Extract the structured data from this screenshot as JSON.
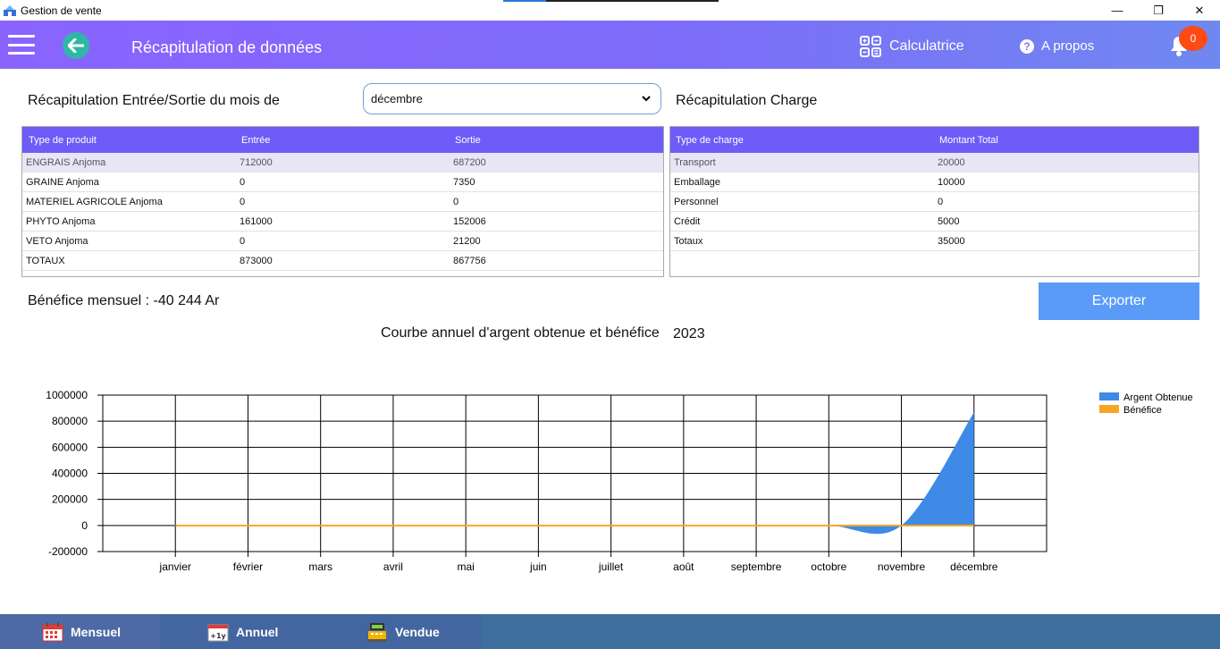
{
  "window": {
    "title": "Gestion de vente",
    "minimize": "—",
    "maximize": "❐",
    "close": "✕"
  },
  "header": {
    "page_title": "Récapitulation de données",
    "calculator_label": "Calculatrice",
    "about_label": "A propos",
    "about_icon": "?",
    "notification_count": "0"
  },
  "entry_section": {
    "title": "Récapitulation Entrée/Sortie  du mois de",
    "selected_month": "décembre",
    "columns": [
      "Type de produit",
      "Entrée",
      "Sortie"
    ],
    "rows": [
      [
        "ENGRAIS Anjoma",
        "712000",
        "687200"
      ],
      [
        "GRAINE Anjoma",
        "0",
        "7350"
      ],
      [
        "MATERIEL AGRICOLE Anjoma",
        "0",
        "0"
      ],
      [
        "PHYTO Anjoma",
        "161000",
        "152006"
      ],
      [
        "VETO Anjoma",
        "0",
        "21200"
      ],
      [
        "TOTAUX",
        "873000",
        "867756"
      ]
    ]
  },
  "charge_section": {
    "title": "Récapitulation Charge",
    "columns": [
      "Type de charge",
      "Montant Total"
    ],
    "rows": [
      [
        "Transport",
        "20000"
      ],
      [
        "Emballage",
        "10000"
      ],
      [
        "Personnel",
        "0"
      ],
      [
        "Crédit",
        "5000"
      ],
      [
        "Totaux",
        "35000"
      ]
    ]
  },
  "benefit": {
    "label": "Bénéfice mensuel :",
    "value": "-40 244 Ar"
  },
  "export_label": "Exporter",
  "chart_heading": {
    "title": "Courbe annuel d'argent obtenue et bénéfice",
    "year": "2023"
  },
  "chart_data": {
    "type": "area",
    "title": "",
    "categories": [
      "janvier",
      "février",
      "mars",
      "avril",
      "mai",
      "juin",
      "juillet",
      "août",
      "septembre",
      "octobre",
      "novembre",
      "décembre"
    ],
    "ylim": [
      -200000,
      1000000
    ],
    "yticks": [
      1000000,
      800000,
      600000,
      400000,
      200000,
      0,
      -200000
    ],
    "grid": true,
    "legend": "top-right",
    "series": [
      {
        "name": "Argent Obtenue",
        "color": "#3e8ae6",
        "values": [
          0,
          0,
          0,
          0,
          0,
          0,
          0,
          0,
          0,
          0,
          0,
          867756
        ]
      },
      {
        "name": "Bénéfice",
        "color": "#f5a623",
        "values": [
          0,
          0,
          0,
          0,
          0,
          0,
          0,
          0,
          0,
          0,
          0,
          0
        ]
      }
    ]
  },
  "bottom_nav": [
    {
      "label": "Mensuel",
      "icon": "calendar-icon"
    },
    {
      "label": "Annuel",
      "icon": "calendar-plus-year-icon",
      "icon_text": "+1y"
    },
    {
      "label": "Vendue",
      "icon": "cash-register-icon"
    }
  ]
}
